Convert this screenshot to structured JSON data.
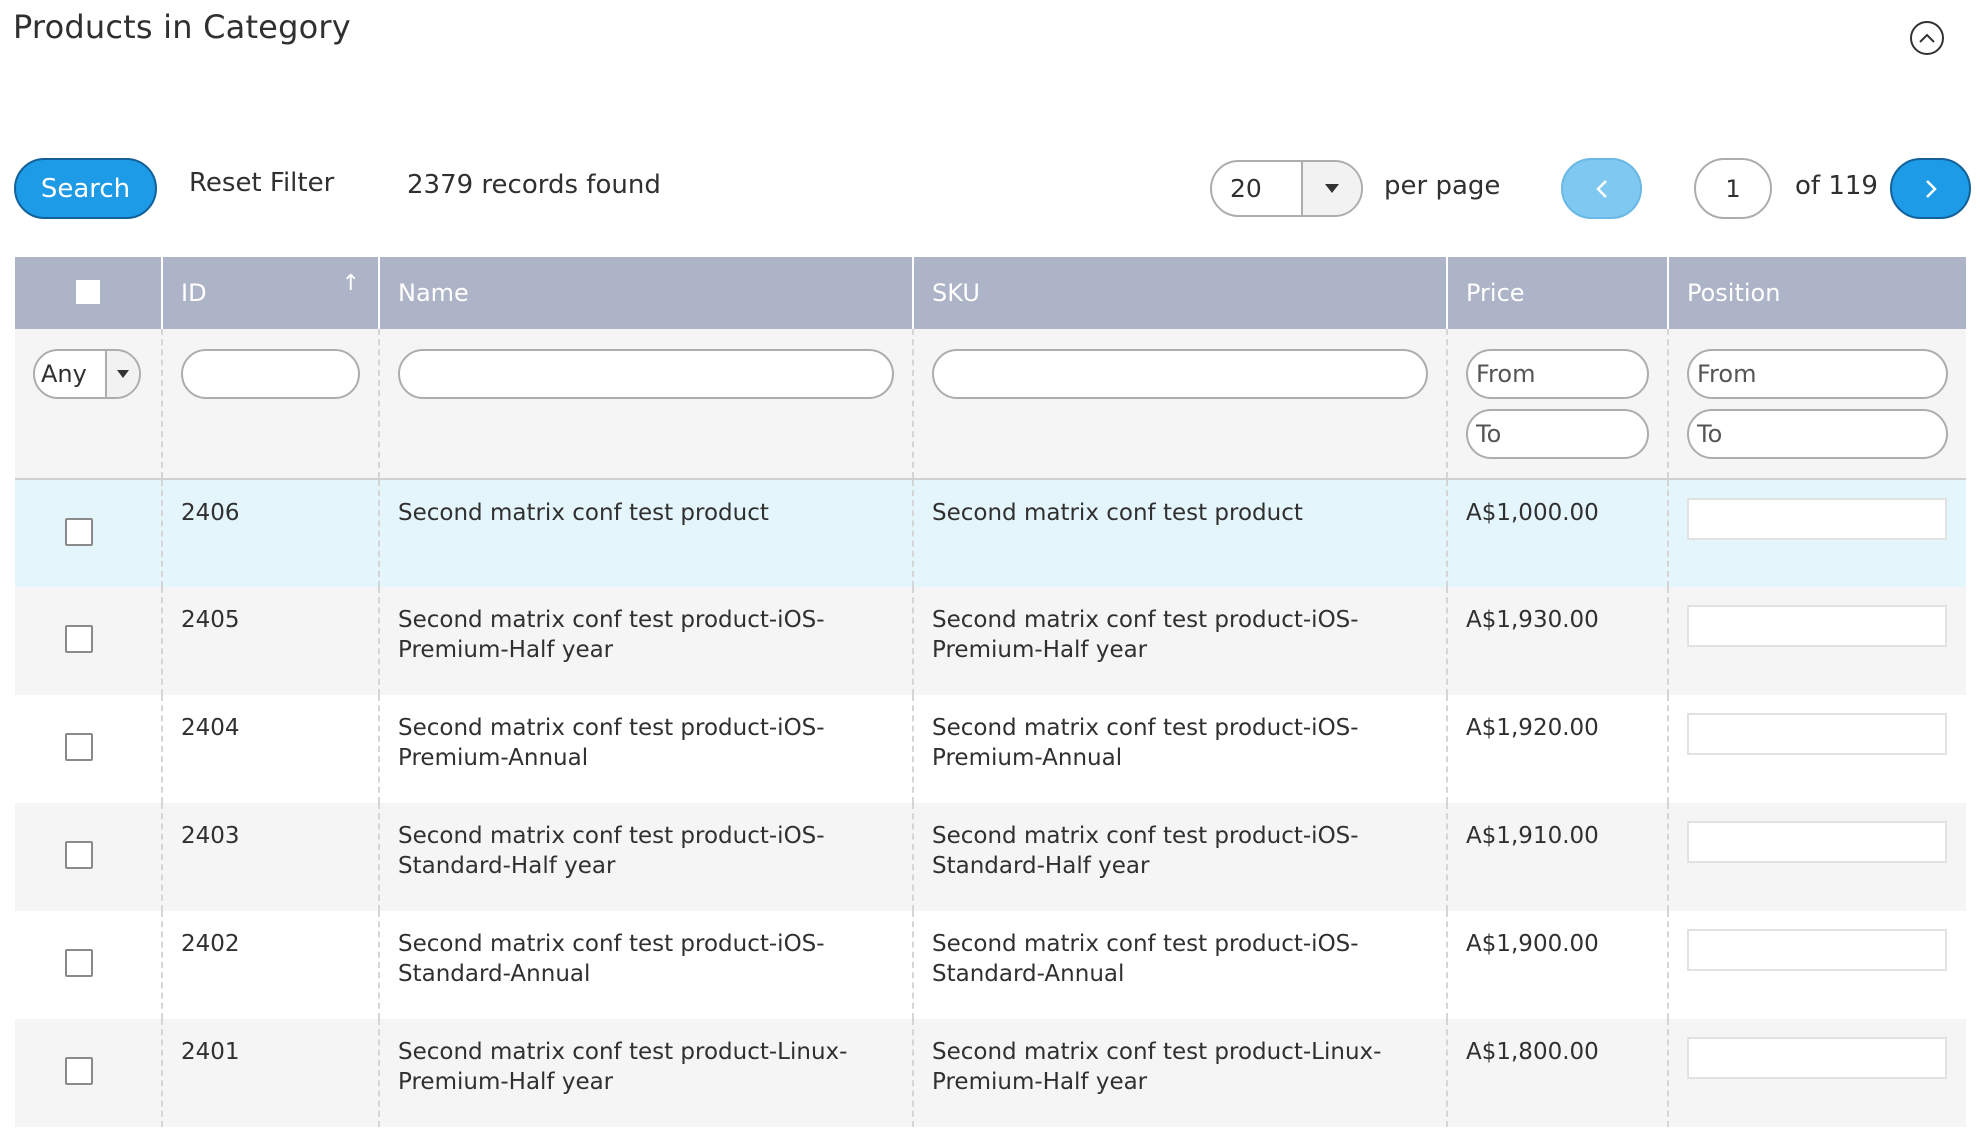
{
  "page": {
    "title": "Products in Category"
  },
  "toolbar": {
    "search_label": "Search",
    "reset_label": "Reset Filter",
    "records_found": "2379 records found",
    "per_page_value": "20",
    "per_page_label": "per page",
    "current_page": "1",
    "of_pages": "of 119"
  },
  "columns": {
    "id": "ID",
    "name": "Name",
    "sku": "SKU",
    "price": "Price",
    "position": "Position"
  },
  "filters": {
    "visibility_value": "Any",
    "price_from_placeholder": "From",
    "price_to_placeholder": "To",
    "position_from_placeholder": "From",
    "position_to_placeholder": "To"
  },
  "rows": [
    {
      "id": "2406",
      "name": "Second matrix conf test product",
      "sku": "Second matrix conf test product",
      "price": "A$1,000.00"
    },
    {
      "id": "2405",
      "name": "Second matrix conf test product-iOS-Premium-Half year",
      "sku": "Second matrix conf test product-iOS-Premium-Half year",
      "price": "A$1,930.00"
    },
    {
      "id": "2404",
      "name": "Second matrix conf test product-iOS-Premium-Annual",
      "sku": "Second matrix conf test product-iOS-Premium-Annual",
      "price": "A$1,920.00"
    },
    {
      "id": "2403",
      "name": "Second matrix conf test product-iOS-Standard-Half year",
      "sku": "Second matrix conf test product-iOS-Standard-Half year",
      "price": "A$1,910.00"
    },
    {
      "id": "2402",
      "name": "Second matrix conf test product-iOS-Standard-Annual",
      "sku": "Second matrix conf test product-iOS-Standard-Annual",
      "price": "A$1,900.00"
    },
    {
      "id": "2401",
      "name": "Second matrix conf test product-Linux-Premium-Half year",
      "sku": "Second matrix conf test product-Linux-Premium-Half year",
      "price": "A$1,800.00"
    }
  ],
  "icons": {
    "collapse": "chevron-up-circle-icon",
    "prev": "chevron-left-icon",
    "next": "chevron-right-icon",
    "dropdown": "caret-down-icon",
    "sort": "sort-ascending-icon"
  },
  "colors": {
    "primary": "#1e9be6",
    "primary_disabled": "#7ec8f2",
    "header_bg": "#adb4c7",
    "selected_row": "#e5f5fc"
  }
}
